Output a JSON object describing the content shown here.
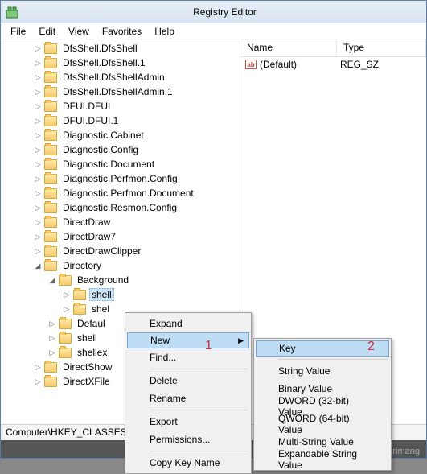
{
  "title": "Registry Editor",
  "menus": {
    "file": "File",
    "edit": "Edit",
    "view": "View",
    "favorites": "Favorites",
    "help": "Help"
  },
  "tree": {
    "items": [
      "DfsShell.DfsShell",
      "DfsShell.DfsShell.1",
      "DfsShell.DfsShellAdmin",
      "DfsShell.DfsShellAdmin.1",
      "DFUI.DFUI",
      "DFUI.DFUI.1",
      "Diagnostic.Cabinet",
      "Diagnostic.Config",
      "Diagnostic.Document",
      "Diagnostic.Perfmon.Config",
      "Diagnostic.Perfmon.Document",
      "Diagnostic.Resmon.Config",
      "DirectDraw",
      "DirectDraw7",
      "DirectDrawClipper"
    ],
    "expanded": "Directory",
    "sub": [
      "Background"
    ],
    "shellSel": "shell",
    "shellSibs": [
      "shel"
    ],
    "others": [
      "Defaul",
      "shell",
      "shellex"
    ],
    "tail": [
      "DirectShow",
      "DirectXFile"
    ]
  },
  "list": {
    "colName": "Name",
    "colType": "Type",
    "valName": "(Default)",
    "valType": "REG_SZ"
  },
  "status": "Computer\\HKEY_CLASSES",
  "ctx1": {
    "expand": "Expand",
    "new": "New",
    "find": "Find...",
    "delete": "Delete",
    "rename": "Rename",
    "export": "Export",
    "perm": "Permissions...",
    "copy": "Copy Key Name"
  },
  "ctx2": {
    "key": "Key",
    "sv": "String Value",
    "bv": "Binary Value",
    "dw": "DWORD (32-bit) Value",
    "qw": "QWORD (64-bit) Value",
    "ms": "Multi-String Value",
    "es": "Expandable String Value"
  },
  "annot": {
    "one": "1",
    "two": "2"
  },
  "watermark": "Quantrimang"
}
